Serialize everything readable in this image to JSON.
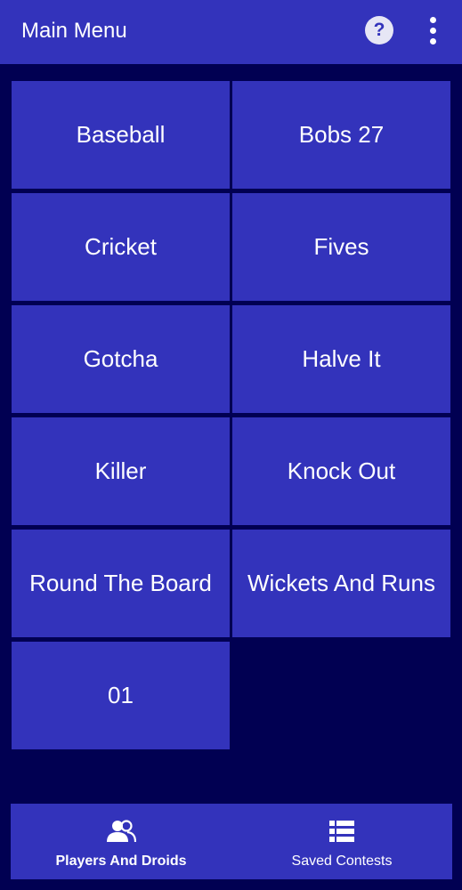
{
  "appbar": {
    "title": "Main Menu",
    "help_icon": "help-circle-icon",
    "help_glyph": "?",
    "more_icon": "more-vert-icon"
  },
  "games": [
    {
      "label": "Baseball"
    },
    {
      "label": "Bobs 27"
    },
    {
      "label": "Cricket"
    },
    {
      "label": "Fives"
    },
    {
      "label": "Gotcha"
    },
    {
      "label": "Halve It"
    },
    {
      "label": "Killer"
    },
    {
      "label": "Knock Out"
    },
    {
      "label": "Round The Board"
    },
    {
      "label": "Wickets And Runs"
    },
    {
      "label": "01"
    }
  ],
  "bottom_nav": [
    {
      "label": "Players And Droids",
      "icon": "people-icon",
      "active": true
    },
    {
      "label": "Saved Contests",
      "icon": "list-icon",
      "active": false
    }
  ],
  "colors": {
    "background": "#010052",
    "primary": "#3333bb",
    "text": "#ffffff"
  }
}
